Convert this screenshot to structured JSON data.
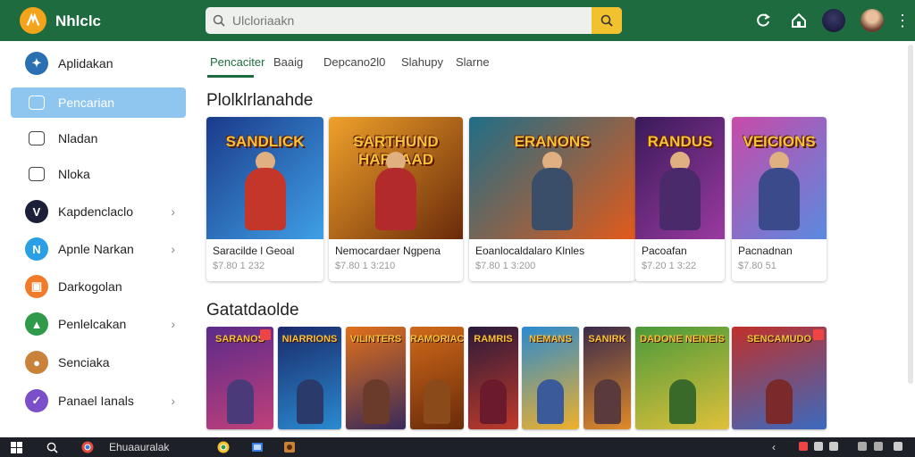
{
  "app": {
    "title": "Nhlclc"
  },
  "search": {
    "placeholder": "Ulcloriaakn"
  },
  "sidebar": {
    "items": [
      {
        "label": "Aplidakan",
        "icon": "compass-icon",
        "color": "#2a6fb2",
        "chevron": false,
        "active": false
      },
      {
        "label": "Pencarian",
        "icon": "doc-icon",
        "color": "#8fc6ef",
        "chevron": false,
        "active": true
      },
      {
        "label": "Nladan",
        "icon": "folder-icon",
        "color": "#ffffff",
        "chevron": false,
        "active": false
      },
      {
        "label": "Nloka",
        "icon": "chat-icon",
        "color": "#ffffff",
        "chevron": false,
        "active": false
      },
      {
        "label": "Kapdenclaclo",
        "icon": "shield-icon",
        "color": "#1b1f3a",
        "chevron": true,
        "active": false
      },
      {
        "label": "Apnle Narkan",
        "icon": "n-icon",
        "color": "#2a9fe6",
        "chevron": true,
        "active": false
      },
      {
        "label": "Darkogolan",
        "icon": "grid-icon",
        "color": "#f07b2a",
        "chevron": false,
        "active": false
      },
      {
        "label": "Penlelcakan",
        "icon": "lock-icon",
        "color": "#2e9a4a",
        "chevron": true,
        "active": false
      },
      {
        "label": "Senciaka",
        "icon": "person-icon",
        "color": "#c8823a",
        "chevron": false,
        "active": false
      },
      {
        "label": "Panael Ianals",
        "icon": "check-icon",
        "color": "#7b4fc9",
        "chevron": true,
        "active": false
      }
    ]
  },
  "tabs": [
    {
      "label": "Pencaciter",
      "active": true
    },
    {
      "label": "Baaig",
      "active": false
    },
    {
      "label": "Depcano2l0",
      "active": false
    },
    {
      "label": "Slahupy",
      "active": false
    },
    {
      "label": "Slarne",
      "active": false
    }
  ],
  "sections": {
    "featured_title": "Plolklrlanahde",
    "games_title": "Gatatdaolde"
  },
  "featured_cards": [
    {
      "art_text": "SANDLICK",
      "title": "Saracilde l Geoal",
      "price": "$7.80 1 232",
      "color_a": "#1b3a8a",
      "color_b": "#3fa0e6",
      "hero_color": "#c4362a"
    },
    {
      "art_text": "SARTHUND HARLAAD",
      "title": "Nemocardaer Ngpena",
      "price": "$7.80 1 3:210",
      "color_a": "#f0a12a",
      "color_b": "#6a2a0a",
      "hero_color": "#b22a2a"
    },
    {
      "art_text": "ERANONS",
      "title": "Eoanlocaldalaro Klnles",
      "price": "$7.80 1 3:200",
      "color_a": "#1f6e88",
      "color_b": "#e25a1a",
      "hero_color": "#3a4e6a"
    },
    {
      "art_text": "RANDUS",
      "title": "Pacoafan",
      "price": "$7.20 1 3:22",
      "color_a": "#3a1a5a",
      "color_b": "#9a3aa0",
      "hero_color": "#4a2a6a"
    },
    {
      "art_text": "VEICIONS",
      "title": "Pacnadnan",
      "price": "$7.80 51",
      "color_a": "#c84aa8",
      "color_b": "#5a8ae0",
      "hero_color": "#3a4a8a"
    }
  ],
  "game_tiles": [
    {
      "art_text": "SARANOS",
      "color_a": "#5a2a8a",
      "color_b": "#c0407a",
      "hero_color": "#4a3a7a"
    },
    {
      "art_text": "NIARRIONS",
      "color_a": "#1a2a6a",
      "color_b": "#2a8ad0",
      "hero_color": "#2a3a6a"
    },
    {
      "art_text": "VILINTERS",
      "color_a": "#e0701a",
      "color_b": "#3a2a5a",
      "hero_color": "#6a3a2a"
    },
    {
      "art_text": "RAMORIAC",
      "color_a": "#d06a1a",
      "color_b": "#6a2a0a",
      "hero_color": "#8a4a1a"
    },
    {
      "art_text": "RAMRIS",
      "color_a": "#2a1a3a",
      "color_b": "#c03a2a",
      "hero_color": "#6a1a2a"
    },
    {
      "art_text": "NEMANS",
      "color_a": "#2a8ad0",
      "color_b": "#f0b02a",
      "hero_color": "#3a5a9a"
    },
    {
      "art_text": "SANIRK",
      "color_a": "#3a2a4a",
      "color_b": "#e08a2a",
      "hero_color": "#5a3a3a"
    },
    {
      "art_text": "DADONE NEINEIS",
      "color_a": "#4a9a3a",
      "color_b": "#e0c03a",
      "hero_color": "#3a6a2a"
    },
    {
      "art_text": "SENCAMUDO",
      "color_a": "#c0302a",
      "color_b": "#3a6ac0",
      "hero_color": "#7a2a2a"
    }
  ],
  "taskbar": {
    "active_app_label": "Ehuaauralak"
  },
  "colors": {
    "header": "#1e6b3f",
    "accent": "#f2c12e",
    "active_nav": "#8fc6ef"
  }
}
